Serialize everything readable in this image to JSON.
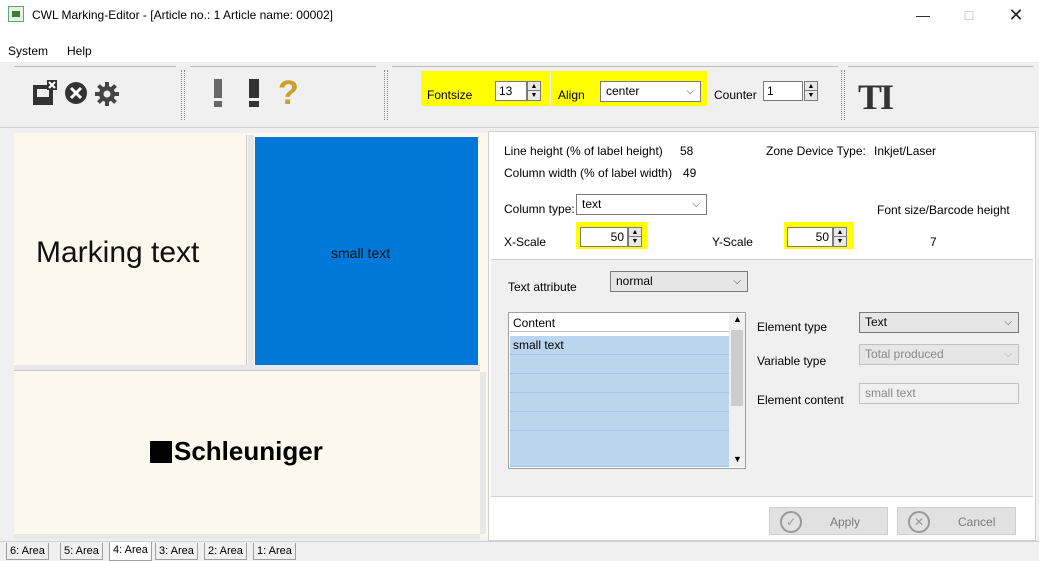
{
  "window": {
    "title": "CWL Marking-Editor - [Article no.: 1   Article name: 00002]",
    "minimize": "—",
    "maximize": "□",
    "close": "✕"
  },
  "menu": {
    "system": "System",
    "help": "Help"
  },
  "toolbar": {
    "icons": [
      "save-close-icon",
      "cancel-circle-icon",
      "settings-gear-icon",
      "exclamation-icon",
      "exclamation-bold-icon",
      "question-icon",
      "text-format-icon"
    ],
    "fontsize_label": "Fontsize",
    "fontsize_value": "13",
    "align_label": "Align",
    "align_value": "center",
    "counter_label": "Counter",
    "counter_value": "1",
    "text_tool": "TI",
    "highlight_color": "#ffff00"
  },
  "preview": {
    "marking_text": "Marking text",
    "small_text": "small text",
    "brand": "Schleuniger",
    "selected_area_color": "#0078d7"
  },
  "props": {
    "line_height_label": "Line height (% of label height)",
    "line_height_value": "58",
    "zone_device_label": "Zone Device Type:",
    "zone_device_value": "Inkjet/Laser",
    "column_width_label": "Column width (% of label width)",
    "column_width_value": "49",
    "column_type_label": "Column type:",
    "column_type_value": "text",
    "font_size_label": "Font size/Barcode height",
    "font_size_value": "7",
    "xscale_label": "X-Scale",
    "xscale_value": "50",
    "yscale_label": "Y-Scale",
    "yscale_value": "50",
    "text_attribute_label": "Text attribute",
    "text_attribute_value": "normal",
    "content_header": "Content",
    "content_rows": [
      "small text",
      "",
      "",
      "",
      "",
      ""
    ],
    "element_type_label": "Element type",
    "element_type_value": "Text",
    "variable_type_label": "Variable type",
    "variable_type_value": "Total produced",
    "element_content_label": "Element content",
    "element_content_value": "small text",
    "apply": "Apply",
    "cancel": "Cancel"
  },
  "tabs": [
    "6: Area",
    "5: Area",
    "4: Area",
    "3: Area",
    "2: Area",
    "1: Area"
  ],
  "active_tab": "4: Area"
}
